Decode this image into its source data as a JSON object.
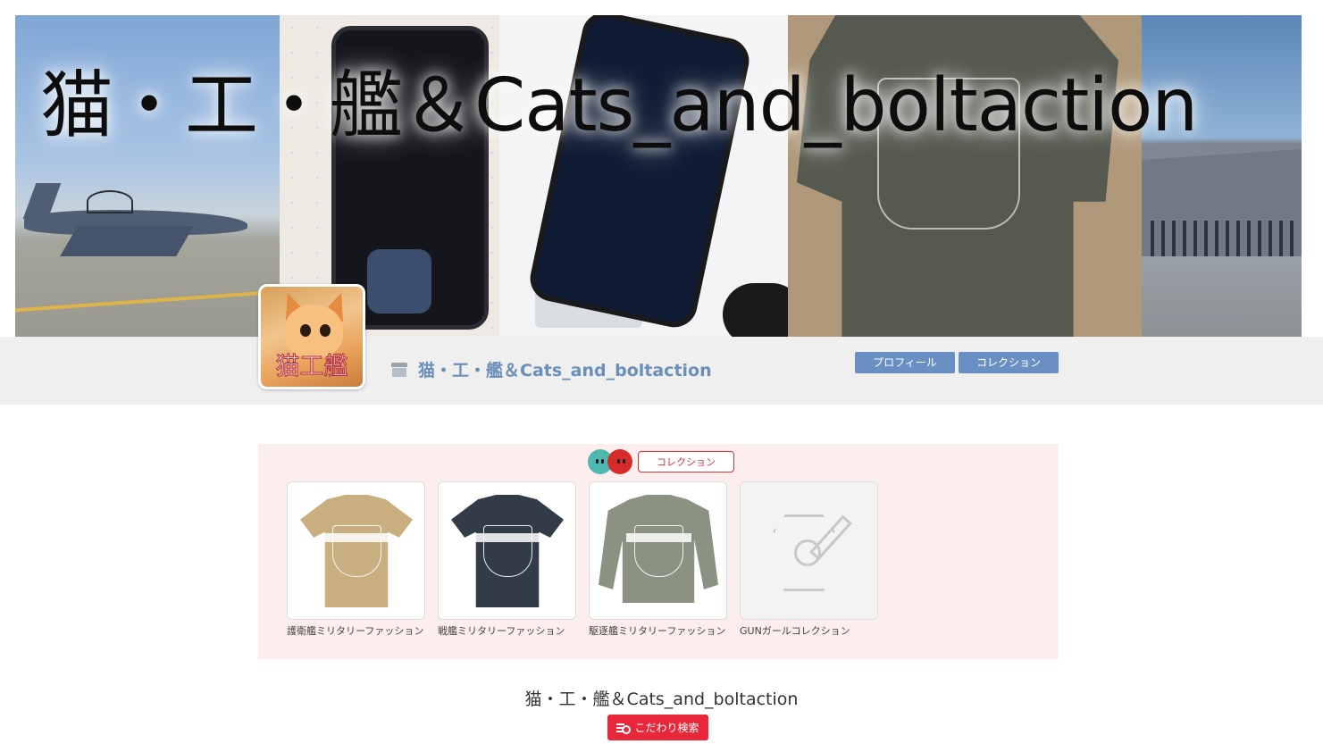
{
  "banner": {
    "title": "猫・工・艦＆Cats_and_boltaction"
  },
  "shop": {
    "name": "猫・工・艦＆Cats_and_boltaction",
    "avatar_text": "猫工艦",
    "store_icon": "store-icon",
    "buttons": {
      "profile": "プロフィール",
      "collection": "コレクション"
    }
  },
  "collection": {
    "tag_label": "コレクション",
    "items": [
      {
        "label": "護衛艦ミリタリーファッション",
        "color": "#c9ae7f",
        "kind": "tshirt"
      },
      {
        "label": "戦艦ミリタリーファッション",
        "color": "#323c48",
        "kind": "tshirt"
      },
      {
        "label": "駆逐艦ミリタリーファッション",
        "color": "#8c9282",
        "kind": "sweatshirt"
      },
      {
        "label": "GUNガールコレクション",
        "color": "#f3f3f3",
        "kind": "placeholder"
      }
    ]
  },
  "footer": {
    "shop_title": "猫・工・艦＆Cats_and_boltaction",
    "search_button": "こだわり検索"
  },
  "colors": {
    "accent_blue": "#6a8fc3",
    "shop_name_blue": "#6a8fb8",
    "collection_bg": "#fdeeee",
    "search_red": "#e8283a"
  }
}
